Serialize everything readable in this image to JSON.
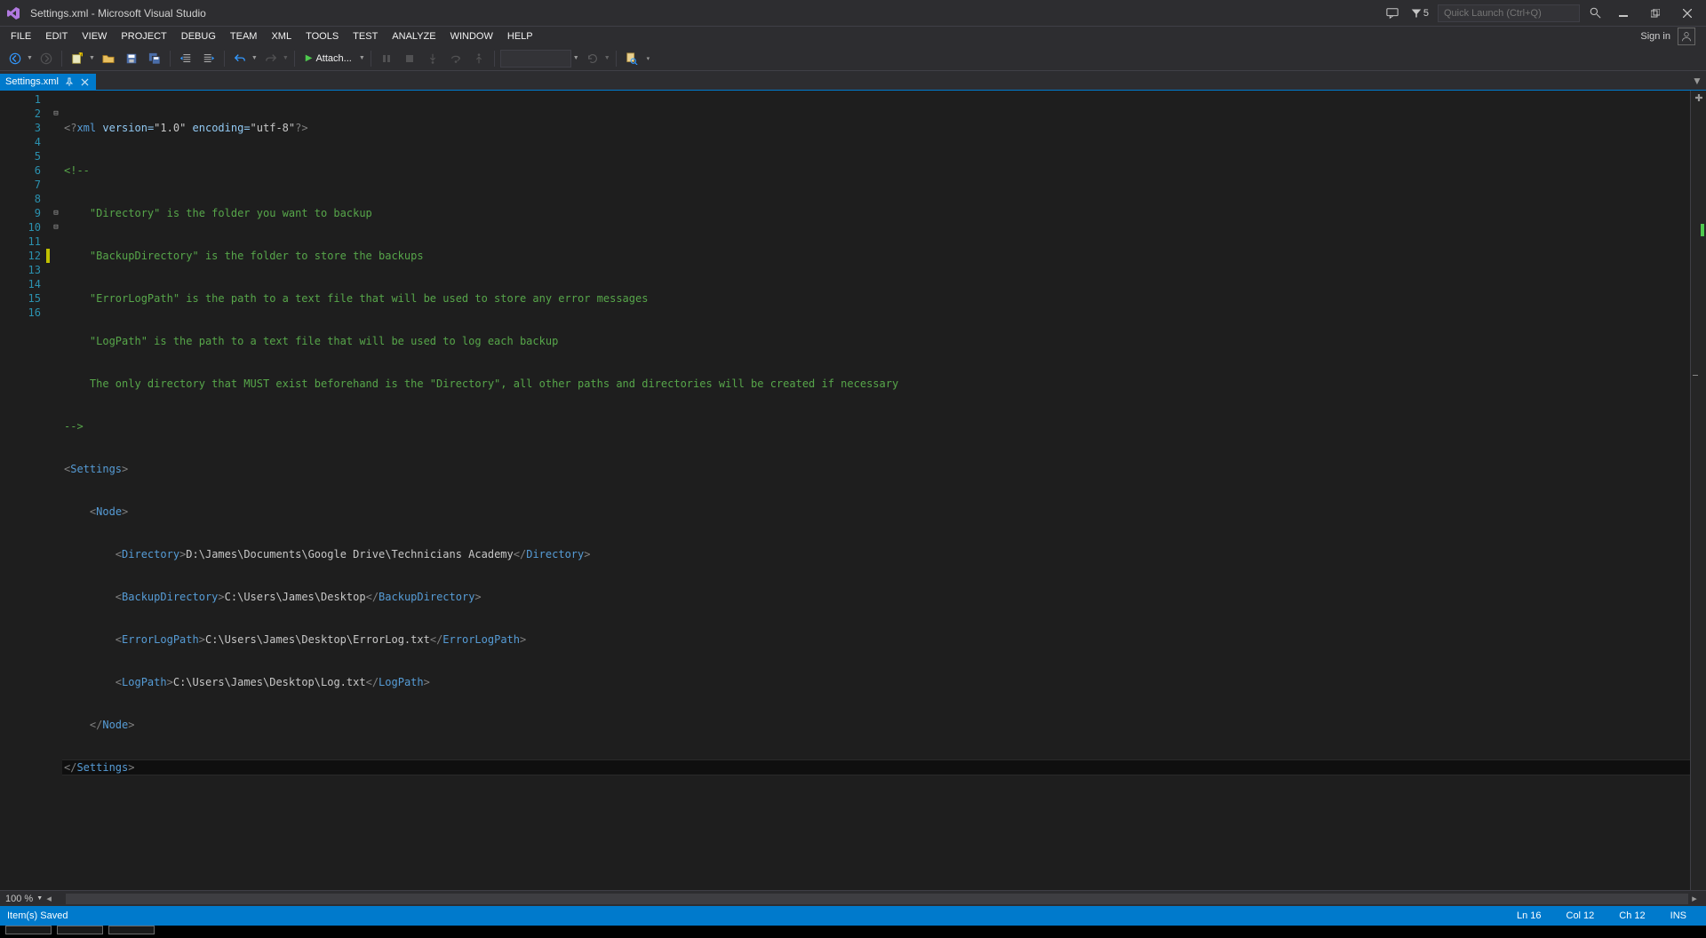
{
  "title": "Settings.xml - Microsoft Visual Studio",
  "notifications_count": "5",
  "quick_launch_placeholder": "Quick Launch (Ctrl+Q)",
  "signin": "Sign in",
  "menu": {
    "file": "FILE",
    "edit": "EDIT",
    "view": "VIEW",
    "project": "PROJECT",
    "debug": "DEBUG",
    "team": "TEAM",
    "xml": "XML",
    "tools": "TOOLS",
    "test": "TEST",
    "analyze": "ANALYZE",
    "window": "WINDOW",
    "help": "HELP"
  },
  "toolbar": {
    "attach": "Attach..."
  },
  "tab": {
    "filename": "Settings.xml"
  },
  "zoom": "100 %",
  "status": {
    "message": "Item(s) Saved",
    "ln": "Ln 16",
    "col": "Col 12",
    "ch": "Ch 12",
    "ins": "INS"
  },
  "code": {
    "l1_pre": "<?",
    "l1_kw": "xml",
    "l1_mid": " version=",
    "l1_v": "\"1.0\"",
    "l1_mid2": " encoding=",
    "l1_e": "\"utf-8\"",
    "l1_post": "?>",
    "l2": "<!--",
    "l3": "    \"Directory\" is the folder you want to backup",
    "l4": "    \"BackupDirectory\" is the folder to store the backups",
    "l5": "    \"ErrorLogPath\" is the path to a text file that will be used to store any error messages",
    "l6": "    \"LogPath\" is the path to a text file that will be used to log each backup",
    "l7": "    The only directory that MUST exist beforehand is the \"Directory\", all other paths and directories will be created if necessary",
    "l8": "-->",
    "l9_o": "<",
    "l9_t": "Settings",
    "l9_c": ">",
    "l10_o": "<",
    "l10_t": "Node",
    "l10_c": ">",
    "l11_o": "<",
    "l11_t": "Directory",
    "l11_c": ">",
    "l11_v": "D:\\James\\Documents\\Google Drive\\Technicians Academy",
    "l11_co": "</",
    "l11_ct": "Directory",
    "l11_cc": ">",
    "l12_o": "<",
    "l12_t": "BackupDirectory",
    "l12_c": ">",
    "l12_v": "C:\\Users\\James\\Desktop",
    "l12_co": "</",
    "l12_ct": "BackupDirectory",
    "l12_cc": ">",
    "l13_o": "<",
    "l13_t": "ErrorLogPath",
    "l13_c": ">",
    "l13_v": "C:\\Users\\James\\Desktop\\ErrorLog.txt",
    "l13_co": "</",
    "l13_ct": "ErrorLogPath",
    "l13_cc": ">",
    "l14_o": "<",
    "l14_t": "LogPath",
    "l14_c": ">",
    "l14_v": "C:\\Users\\James\\Desktop\\Log.txt",
    "l14_co": "</",
    "l14_ct": "LogPath",
    "l14_cc": ">",
    "l15_o": "</",
    "l15_t": "Node",
    "l15_c": ">",
    "l16_o": "</",
    "l16_t": "Settings",
    "l16_c": ">"
  },
  "line_numbers": [
    "1",
    "2",
    "3",
    "4",
    "5",
    "6",
    "7",
    "8",
    "9",
    "10",
    "11",
    "12",
    "13",
    "14",
    "15",
    "16"
  ]
}
